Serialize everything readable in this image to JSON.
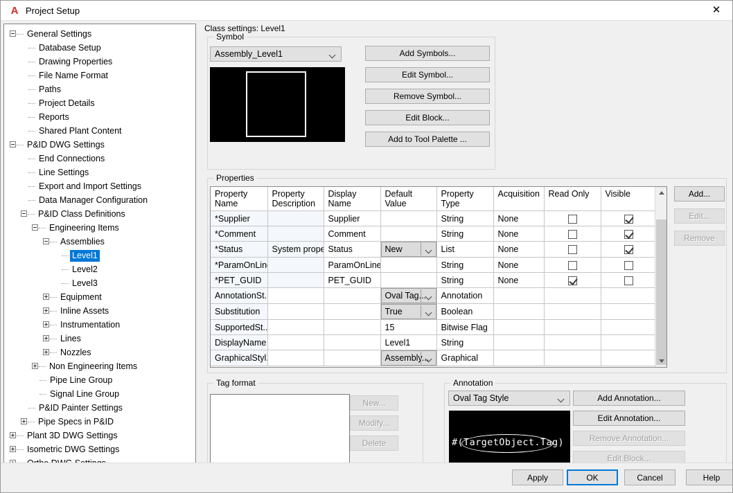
{
  "window": {
    "title": "Project Setup",
    "logo_icon": "autodesk-a-icon",
    "close_icon": "close-icon"
  },
  "tree": {
    "nodes": [
      {
        "label": "General Settings",
        "depth": 0,
        "toggle": "minus"
      },
      {
        "label": "Database Setup",
        "depth": 1,
        "toggle": "none"
      },
      {
        "label": "Drawing Properties",
        "depth": 1,
        "toggle": "none"
      },
      {
        "label": "File Name Format",
        "depth": 1,
        "toggle": "none"
      },
      {
        "label": "Paths",
        "depth": 1,
        "toggle": "none"
      },
      {
        "label": "Project Details",
        "depth": 1,
        "toggle": "none"
      },
      {
        "label": "Reports",
        "depth": 1,
        "toggle": "none"
      },
      {
        "label": "Shared Plant Content",
        "depth": 1,
        "toggle": "none"
      },
      {
        "label": "P&ID DWG Settings",
        "depth": 0,
        "toggle": "minus"
      },
      {
        "label": "End Connections",
        "depth": 1,
        "toggle": "none"
      },
      {
        "label": "Line Settings",
        "depth": 1,
        "toggle": "none"
      },
      {
        "label": "Export and Import Settings",
        "depth": 1,
        "toggle": "none"
      },
      {
        "label": "Data Manager Configuration",
        "depth": 1,
        "toggle": "none"
      },
      {
        "label": "P&ID Class Definitions",
        "depth": 1,
        "toggle": "minus"
      },
      {
        "label": "Engineering Items",
        "depth": 2,
        "toggle": "minus"
      },
      {
        "label": "Assemblies",
        "depth": 3,
        "toggle": "minus"
      },
      {
        "label": "Level1",
        "depth": 4,
        "toggle": "none",
        "selected": true
      },
      {
        "label": "Level2",
        "depth": 4,
        "toggle": "none"
      },
      {
        "label": "Level3",
        "depth": 4,
        "toggle": "none"
      },
      {
        "label": "Equipment",
        "depth": 3,
        "toggle": "plus"
      },
      {
        "label": "Inline Assets",
        "depth": 3,
        "toggle": "plus"
      },
      {
        "label": "Instrumentation",
        "depth": 3,
        "toggle": "plus"
      },
      {
        "label": "Lines",
        "depth": 3,
        "toggle": "plus"
      },
      {
        "label": "Nozzles",
        "depth": 3,
        "toggle": "plus"
      },
      {
        "label": "Non Engineering Items",
        "depth": 2,
        "toggle": "plus"
      },
      {
        "label": "Pipe Line Group",
        "depth": 2,
        "toggle": "none"
      },
      {
        "label": "Signal Line Group",
        "depth": 2,
        "toggle": "none"
      },
      {
        "label": "P&ID Painter Settings",
        "depth": 1,
        "toggle": "none"
      },
      {
        "label": "Pipe Specs in P&ID",
        "depth": 1,
        "toggle": "plus"
      },
      {
        "label": "Plant 3D DWG Settings",
        "depth": 0,
        "toggle": "plus"
      },
      {
        "label": "Isometric DWG Settings",
        "depth": 0,
        "toggle": "plus"
      },
      {
        "label": "Ortho DWG Settings",
        "depth": 0,
        "toggle": "plus"
      }
    ]
  },
  "class_settings": {
    "heading": "Class settings: Level1"
  },
  "symbol": {
    "group_title": "Symbol",
    "combo_value": "Assembly_Level1",
    "combo_arrow_icon": "chevron-down-icon",
    "preview_name": "symbol-preview",
    "buttons": [
      {
        "label": "Add Symbols...",
        "enabled": true
      },
      {
        "label": "Edit Symbol...",
        "enabled": true
      },
      {
        "label": "Remove Symbol...",
        "enabled": true
      },
      {
        "label": "Edit Block...",
        "enabled": true
      },
      {
        "label": "Add to Tool Palette ...",
        "enabled": true
      }
    ]
  },
  "properties": {
    "group_title": "Properties",
    "columns": [
      "Property Name",
      "Property Description",
      "Display Name",
      "Default Value",
      "Property Type",
      "Acquisition",
      "Read Only",
      "Visible"
    ],
    "rows": [
      {
        "name": "*Supplier",
        "description": "",
        "display_name": "Supplier",
        "default_value": "",
        "default_is_combo": false,
        "type": "String",
        "acquisition": "None",
        "read_only": false,
        "visible": true,
        "has_checkboxes": true
      },
      {
        "name": "*Comment",
        "description": "",
        "display_name": "Comment",
        "default_value": "",
        "default_is_combo": false,
        "type": "String",
        "acquisition": "None",
        "read_only": false,
        "visible": true,
        "has_checkboxes": true
      },
      {
        "name": "*Status",
        "description": "System prope...",
        "display_name": "Status",
        "default_value": "New",
        "default_is_combo": true,
        "type": "List",
        "acquisition": "None",
        "read_only": false,
        "visible": true,
        "has_checkboxes": true
      },
      {
        "name": "*ParamOnLine",
        "description": "",
        "display_name": "ParamOnLine",
        "default_value": "",
        "default_is_combo": false,
        "type": "String",
        "acquisition": "None",
        "read_only": false,
        "visible": false,
        "has_checkboxes": true
      },
      {
        "name": "*PET_GUID",
        "description": "",
        "display_name": "PET_GUID",
        "default_value": "",
        "default_is_combo": false,
        "type": "String",
        "acquisition": "None",
        "read_only": true,
        "visible": false,
        "has_checkboxes": true
      },
      {
        "name": "AnnotationSt...",
        "description": "",
        "display_name": "",
        "default_value": "Oval Tag...",
        "default_is_combo": true,
        "type": "Annotation",
        "acquisition": "",
        "read_only": null,
        "visible": null,
        "has_checkboxes": false
      },
      {
        "name": "Substitution",
        "description": "",
        "display_name": "",
        "default_value": "True",
        "default_is_combo": true,
        "type": "Boolean",
        "acquisition": "",
        "read_only": null,
        "visible": null,
        "has_checkboxes": false
      },
      {
        "name": "SupportedSt...",
        "description": "",
        "display_name": "",
        "default_value": "15",
        "default_is_combo": false,
        "type": "Bitwise Flag",
        "acquisition": "",
        "read_only": null,
        "visible": null,
        "has_checkboxes": false
      },
      {
        "name": "DisplayName",
        "description": "",
        "display_name": "",
        "default_value": "Level1",
        "default_is_combo": false,
        "type": "String",
        "acquisition": "",
        "read_only": null,
        "visible": null,
        "has_checkboxes": false
      },
      {
        "name": "GraphicalStyl...",
        "description": "",
        "display_name": "",
        "default_value": "Assembly...",
        "default_is_combo": true,
        "type": "Graphical",
        "acquisition": "",
        "read_only": null,
        "visible": null,
        "has_checkboxes": false
      }
    ],
    "side_buttons": [
      {
        "label": "Add...",
        "enabled": true
      },
      {
        "label": "Edit...",
        "enabled": false
      },
      {
        "label": "Remove",
        "enabled": false
      }
    ],
    "scrollbar": {
      "up_icon": "scroll-up-arrow-icon",
      "down_icon": "scroll-down-arrow-icon"
    }
  },
  "tag_format": {
    "group_title": "Tag format",
    "list_items": [],
    "buttons": [
      {
        "label": "New...",
        "enabled": false
      },
      {
        "label": "Modify...",
        "enabled": false
      },
      {
        "label": "Delete",
        "enabled": false
      }
    ]
  },
  "annotation": {
    "group_title": "Annotation",
    "combo_value": "Oval Tag Style",
    "combo_arrow_icon": "chevron-down-icon",
    "preview_text": "#(TargetObject.Tag)",
    "buttons": [
      {
        "label": "Add Annotation...",
        "enabled": true
      },
      {
        "label": "Edit Annotation...",
        "enabled": true
      },
      {
        "label": "Remove Annotation...",
        "enabled": false
      },
      {
        "label": "Edit Block...",
        "enabled": false
      }
    ]
  },
  "footer": {
    "buttons": [
      {
        "label": "Apply",
        "enabled": true,
        "default": false
      },
      {
        "label": "OK",
        "enabled": true,
        "default": true
      },
      {
        "label": "Cancel",
        "enabled": true,
        "default": false
      },
      {
        "label": "Help",
        "enabled": true,
        "default": false
      }
    ]
  },
  "colors": {
    "accent": "#0078d7",
    "window_bg": "#f0f0f0",
    "selection": "#0078d7",
    "logo_red": "#d32d27",
    "preview_black": "#000000",
    "row_tint": "#f4f7fb"
  }
}
